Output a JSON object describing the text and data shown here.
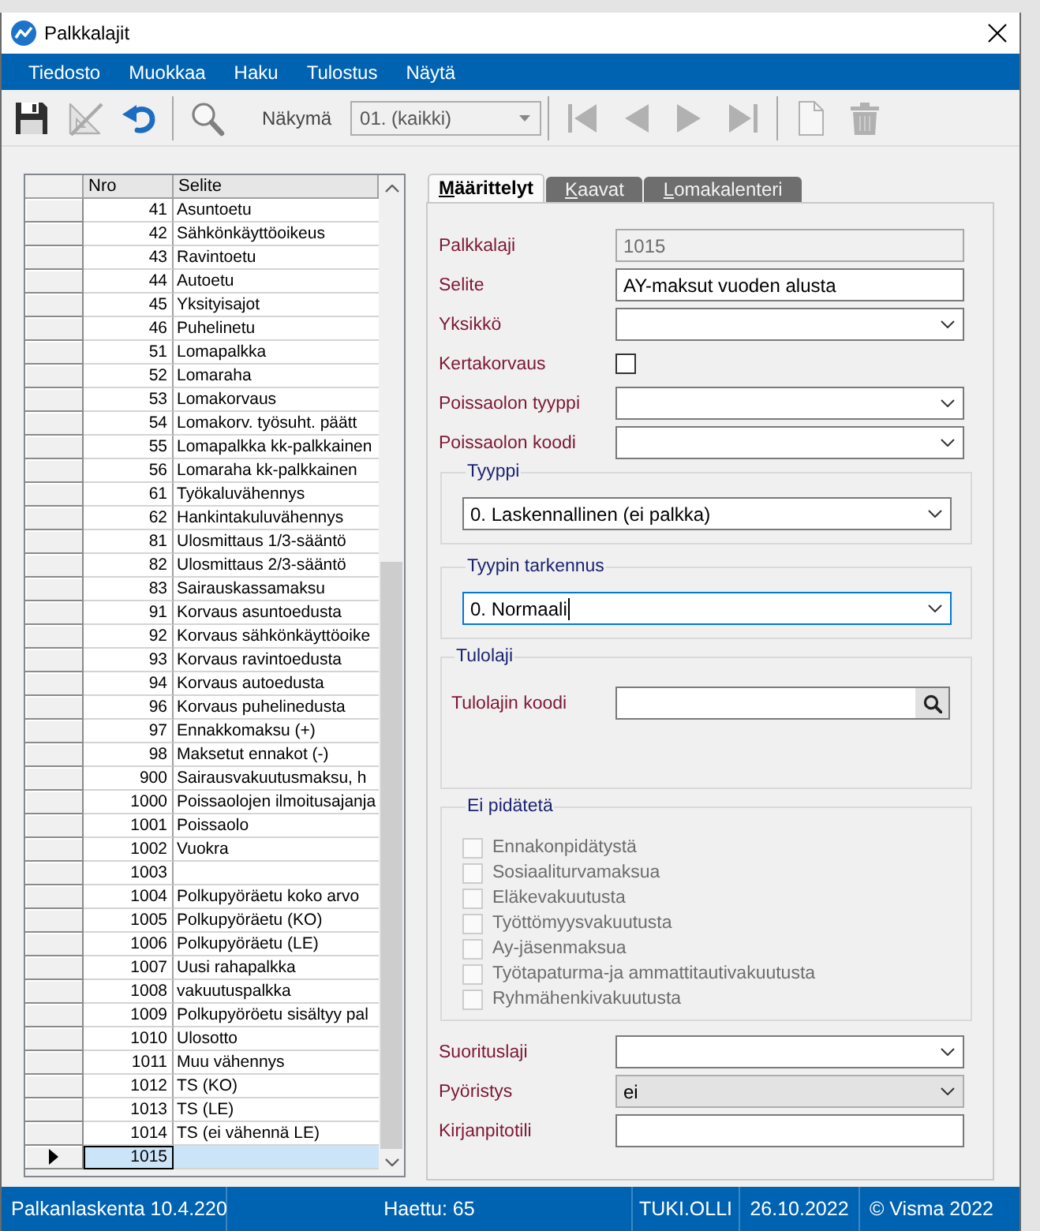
{
  "window": {
    "title": "Palkkalajit"
  },
  "menu": [
    "Tiedosto",
    "Muokkaa",
    "Haku",
    "Tulostus",
    "Näytä"
  ],
  "toolbar": [
    {
      "kind": "save",
      "disabled": false
    },
    {
      "kind": "set-square",
      "disabled": true
    },
    {
      "kind": "undo",
      "disabled": false
    },
    {
      "kind": "separator"
    },
    {
      "kind": "search",
      "disabled": false
    },
    {
      "kind": "view",
      "label": "Näkymä",
      "value": "01. (kaikki)",
      "disabled": true
    },
    {
      "kind": "separator"
    },
    {
      "kind": "first",
      "disabled": true
    },
    {
      "kind": "previous",
      "disabled": true
    },
    {
      "kind": "next",
      "disabled": true
    },
    {
      "kind": "last",
      "disabled": true
    },
    {
      "kind": "separator"
    },
    {
      "kind": "new",
      "disabled": true
    },
    {
      "kind": "delete",
      "disabled": true
    }
  ],
  "grid": {
    "columns": [
      "Nro",
      "Selite"
    ],
    "rows": [
      {
        "nro": "41",
        "selite": "Asuntoetu",
        "selected": false
      },
      {
        "nro": "42",
        "selite": "Sähkönkäyttöoikeus",
        "selected": false
      },
      {
        "nro": "43",
        "selite": "Ravintoetu",
        "selected": false
      },
      {
        "nro": "44",
        "selite": "Autoetu",
        "selected": false
      },
      {
        "nro": "45",
        "selite": "Yksityisajot",
        "selected": false
      },
      {
        "nro": "46",
        "selite": "Puhelinetu",
        "selected": false
      },
      {
        "nro": "51",
        "selite": "Lomapalkka",
        "selected": false
      },
      {
        "nro": "52",
        "selite": "Lomaraha",
        "selected": false
      },
      {
        "nro": "53",
        "selite": "Lomakorvaus",
        "selected": false
      },
      {
        "nro": "54",
        "selite": "Lomakorv. työsuht. päätt",
        "selected": false
      },
      {
        "nro": "55",
        "selite": "Lomapalkka kk-palkkainen",
        "selected": false
      },
      {
        "nro": "56",
        "selite": "Lomaraha kk-palkkainen",
        "selected": false
      },
      {
        "nro": "61",
        "selite": "Työkaluvähennys",
        "selected": false
      },
      {
        "nro": "62",
        "selite": "Hankintakuluvähennys",
        "selected": false
      },
      {
        "nro": "81",
        "selite": "Ulosmittaus 1/3-sääntö",
        "selected": false
      },
      {
        "nro": "82",
        "selite": "Ulosmittaus 2/3-sääntö",
        "selected": false
      },
      {
        "nro": "83",
        "selite": "Sairauskassamaksu",
        "selected": false
      },
      {
        "nro": "91",
        "selite": "Korvaus asuntoedusta",
        "selected": false
      },
      {
        "nro": "92",
        "selite": "Korvaus sähkönkäyttöoike",
        "selected": false
      },
      {
        "nro": "93",
        "selite": "Korvaus ravintoedusta",
        "selected": false
      },
      {
        "nro": "94",
        "selite": "Korvaus autoedusta",
        "selected": false
      },
      {
        "nro": "96",
        "selite": "Korvaus puhelinedusta",
        "selected": false
      },
      {
        "nro": "97",
        "selite": "Ennakkomaksu (+)",
        "selected": false
      },
      {
        "nro": "98",
        "selite": "Maksetut ennakot (-)",
        "selected": false
      },
      {
        "nro": "900",
        "selite": "Sairausvakuutusmaksu, h",
        "selected": false
      },
      {
        "nro": "1000",
        "selite": "Poissaolojen ilmoitusajanja",
        "selected": false
      },
      {
        "nro": "1001",
        "selite": "Poissaolo",
        "selected": false
      },
      {
        "nro": "1002",
        "selite": "Vuokra",
        "selected": false
      },
      {
        "nro": "1003",
        "selected": false
      },
      {
        "nro": "1004",
        "selite": "Polkupyöräetu koko arvo",
        "selected": false
      },
      {
        "nro": "1005",
        "selite": "Polkupyöräetu (KO)",
        "selected": false
      },
      {
        "nro": "1006",
        "selite": "Polkupyöräetu (LE)",
        "selected": false
      },
      {
        "nro": "1007",
        "selite": "Uusi rahapalkka",
        "selected": false
      },
      {
        "nro": "1008",
        "selite": "vakuutuspalkka",
        "selected": false
      },
      {
        "nro": "1009",
        "selite": "Polkupyöröetu sisältyy pal",
        "selected": false
      },
      {
        "nro": "1010",
        "selite": "Ulosotto",
        "selected": false
      },
      {
        "nro": "1011",
        "selite": "Muu vähennys",
        "selected": false
      },
      {
        "nro": "1012",
        "selite": "TS (KO)",
        "selected": false
      },
      {
        "nro": "1013",
        "selite": "TS (LE)",
        "selected": false
      },
      {
        "nro": "1014",
        "selite": "TS (ei vähennä LE)",
        "selected": false
      },
      {
        "nro": "1015",
        "selected": true
      }
    ]
  },
  "tabs": [
    {
      "label": "Määrittelyt",
      "selected": true
    },
    {
      "label": "Kaavat",
      "selected": false
    },
    {
      "label": "Lomakalenteri",
      "selected": false
    }
  ],
  "form": [
    {
      "kind": "text",
      "label": "Palkkalaji",
      "value": "1015",
      "disabled": true
    },
    {
      "kind": "text",
      "label": "Selite",
      "value": "AY-maksut vuoden alusta",
      "disabled": false
    },
    {
      "kind": "select",
      "label": "Yksikkö",
      "disabled": false
    },
    {
      "kind": "checkbox",
      "label": "Kertakorvaus",
      "checked": false
    },
    {
      "kind": "select",
      "label": "Poissaolon tyyppi",
      "disabled": false
    },
    {
      "kind": "select",
      "label": "Poissaolon koodi",
      "disabled": false
    },
    {
      "kind": "group",
      "title": "Tyyppi",
      "items": [
        {
          "kind": "select",
          "value": "0. Laskennallinen (ei palkka)",
          "focused": false
        }
      ]
    },
    {
      "kind": "group",
      "title": "Tyypin tarkennus",
      "items": [
        {
          "kind": "select",
          "value": "0. Normaali",
          "focused": true
        }
      ]
    },
    {
      "kind": "group",
      "title": "Tulolaji",
      "items": [
        {
          "kind": "lookup",
          "label": "Tulolajin koodi"
        }
      ]
    },
    {
      "kind": "group",
      "title": "Ei pidätetä",
      "items": [
        {
          "kind": "check-item",
          "label": "Ennakonpidätystä",
          "checked": false,
          "disabled": true
        },
        {
          "kind": "check-item",
          "label": "Sosiaaliturvamaksua",
          "checked": false,
          "disabled": true
        },
        {
          "kind": "check-item",
          "label": "Eläkevakuutusta",
          "checked": false,
          "disabled": true
        },
        {
          "kind": "check-item",
          "label": "Työttömyysvakuutusta",
          "checked": false,
          "disabled": true
        },
        {
          "kind": "check-item",
          "label": "Ay-jäsenmaksua",
          "checked": false,
          "disabled": true
        },
        {
          "kind": "check-item",
          "label": "Työtapaturma-ja ammattitautivakuutusta",
          "checked": false,
          "disabled": true
        },
        {
          "kind": "check-item",
          "label": "Ryhmähenkivakuutusta",
          "checked": false,
          "disabled": true
        }
      ]
    },
    {
      "kind": "select",
      "label": "Suorituslaji",
      "disabled": false
    },
    {
      "kind": "select",
      "label": "Pyöristys",
      "value": "ei",
      "disabled": true
    },
    {
      "kind": "text",
      "label": "Kirjanpitotili",
      "disabled": false
    }
  ],
  "status_bar": [
    "Palkanlaskenta 10.4.220",
    "Haettu: 65",
    "TUKI.OLLI",
    "26.10.2022",
    "© Visma 2022"
  ]
}
